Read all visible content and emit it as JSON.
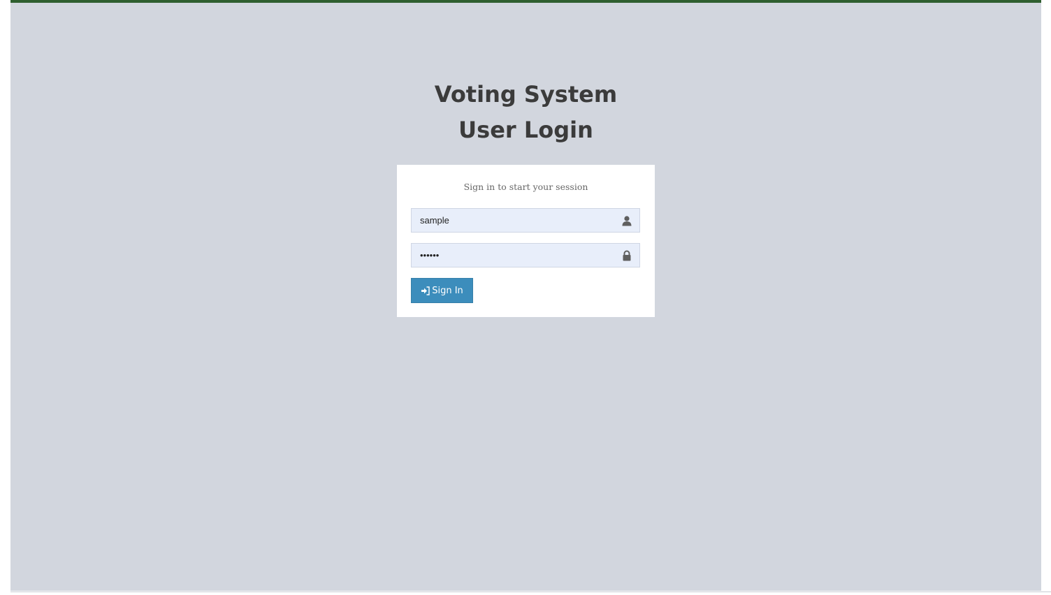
{
  "header": {
    "title_line1": "Voting System",
    "title_line2": "User Login"
  },
  "login": {
    "message": "Sign in to start your session",
    "username_value": "sample",
    "password_value": "••••••",
    "signin_label": "Sign In",
    "username_icon": "user-icon",
    "password_icon": "lock-icon",
    "signin_icon": "sign-in-icon"
  },
  "colors": {
    "background": "#d2d6de",
    "topbar": "#2f5f2f",
    "button": "#3c8dbc",
    "input_bg": "#e8eefa"
  }
}
